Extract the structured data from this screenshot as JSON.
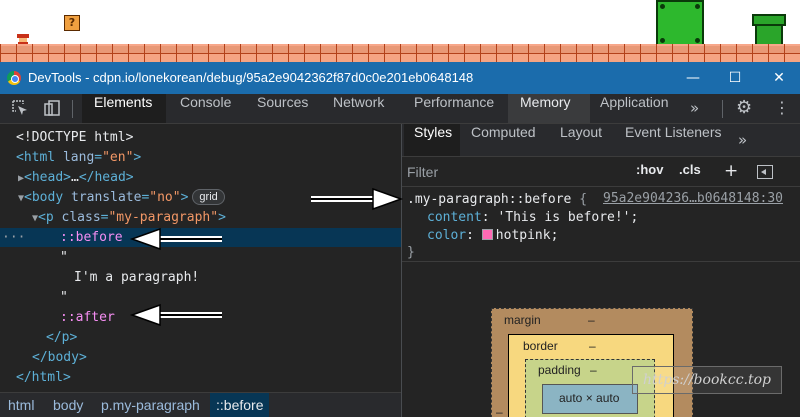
{
  "game": {
    "question_block": "?"
  },
  "window": {
    "title": "DevTools - cdpn.io/lonekorean/debug/95a2e9042362f87d0c0e201eb0648148",
    "minimize": "—",
    "maximize": "☐",
    "close": "✕"
  },
  "toolbar": {
    "inspect_icon": "inspect-element-icon",
    "device_icon": "device-toolbar-icon",
    "tabs": [
      "Elements",
      "Console",
      "Sources",
      "Network",
      "Performance",
      "Memory",
      "Application"
    ],
    "active_tab": "Elements",
    "more": "»",
    "settings": "⚙",
    "menu": "⋮"
  },
  "dom": {
    "doctype": "<!DOCTYPE html>",
    "html_open_tag": "<html",
    "html_lang_attr": "lang",
    "html_lang_value": "\"en\"",
    "tag_close": ">",
    "head_collapsed_start": "<head>",
    "head_ellipsis": "…",
    "head_collapsed_end": "</head>",
    "body_open_tag": "<body",
    "body_attr": "translate",
    "body_attr_value": "\"no\"",
    "grid_badge": "grid",
    "p_open_tag": "<p",
    "p_attr": "class",
    "p_attr_value": "\"my-paragraph\"",
    "before": "::before",
    "quote_open": "\"",
    "paragraph_text": "I'm a paragraph!",
    "quote_close": "\"",
    "after": "::after",
    "p_close": "</p>",
    "body_close": "</body>",
    "html_close": "</html>",
    "selected_marker": "···"
  },
  "breadcrumb": [
    "html",
    "body",
    "p.my-paragraph",
    "::before"
  ],
  "styles_pane": {
    "tabs": [
      "Styles",
      "Computed",
      "Layout",
      "Event Listeners"
    ],
    "active_tab": "Styles",
    "more": "»",
    "filter_placeholder": "Filter",
    "hov": ":hov",
    "cls": ".cls",
    "add": "+",
    "rule": {
      "selector": ".my-paragraph::before",
      "open_brace": "{",
      "source": "95a2e904236…b0648148:30",
      "declarations": [
        {
          "property": "content",
          "value": "'This is before!';"
        },
        {
          "property": "color",
          "value": "hotpink;",
          "swatch": "#ff69b4"
        }
      ],
      "close_brace": "}"
    },
    "box_model": {
      "margin": "margin",
      "margin_value": "–",
      "border": "border",
      "border_value": "–",
      "padding": "padding",
      "padding_value": "–",
      "content": "auto × auto",
      "left_dash": "–",
      "right_dash": "–"
    }
  },
  "watermark": "https://bookcc.top",
  "colors": {
    "titlebar": "#1b6cac",
    "selected_row": "#073655",
    "pseudo_element": "#f68ef3",
    "hotpink": "#ff69b4"
  }
}
